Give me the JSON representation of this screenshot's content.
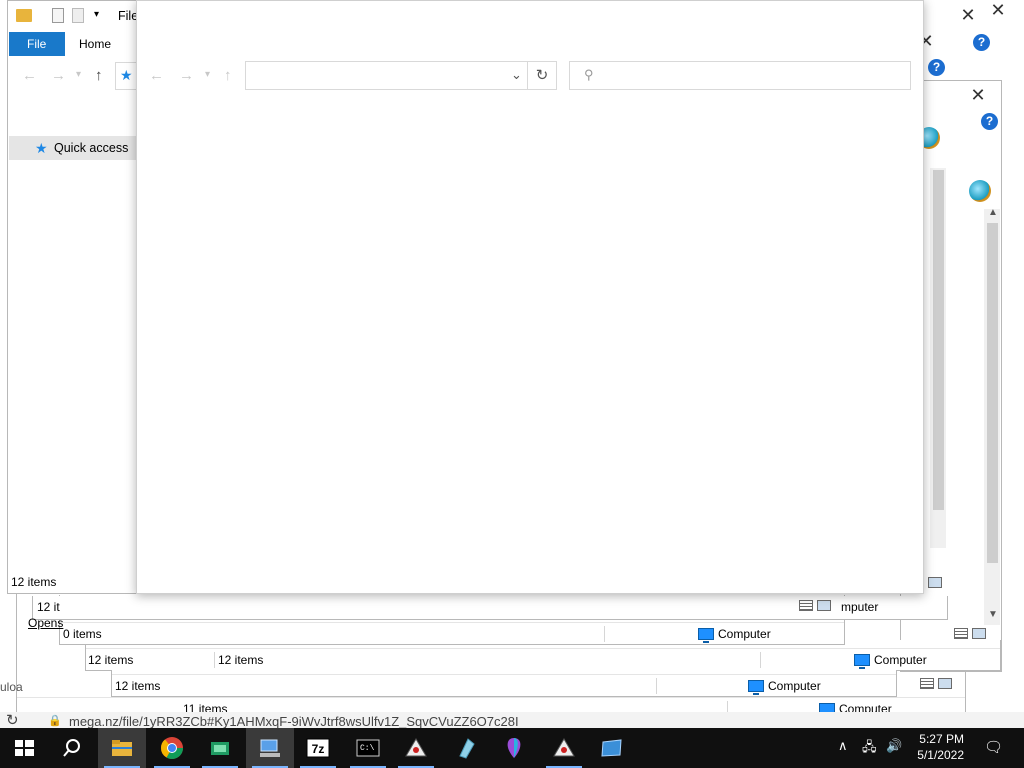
{
  "main_window": {
    "title": "File",
    "tabs": [
      "File",
      "Home"
    ],
    "nav": {
      "quick_access": "Quick access"
    },
    "status": "12 items"
  },
  "background_windows": [
    {
      "status_left": "12 it",
      "status_right": "mputer"
    },
    {
      "status_left": "0 items",
      "status_right": "Computer"
    },
    {
      "status_left": "12 items",
      "status_mid": "12 items",
      "status_right": "Computer"
    },
    {
      "status_left": "12 items",
      "status_right": "Computer"
    },
    {
      "status_left": "11 items",
      "status_right": "Computer"
    }
  ],
  "side_texts": {
    "opens": "Opens",
    "uploa": "uloa"
  },
  "browser": {
    "url": "mega.nz/file/1yRR3ZCb#Ky1AHMxqF-9iWvJtrf8wsUlfv1Z_SqvCVuZZ6O7c28I"
  },
  "taskbar": {
    "time": "5:27 PM",
    "date": "5/1/2022",
    "apps": [
      "start",
      "search",
      "file-explorer",
      "chrome",
      "app-green",
      "app-pc",
      "7zip",
      "cmd",
      "app-java",
      "app-prism",
      "app-balloon",
      "app-java2",
      "app-window"
    ]
  }
}
